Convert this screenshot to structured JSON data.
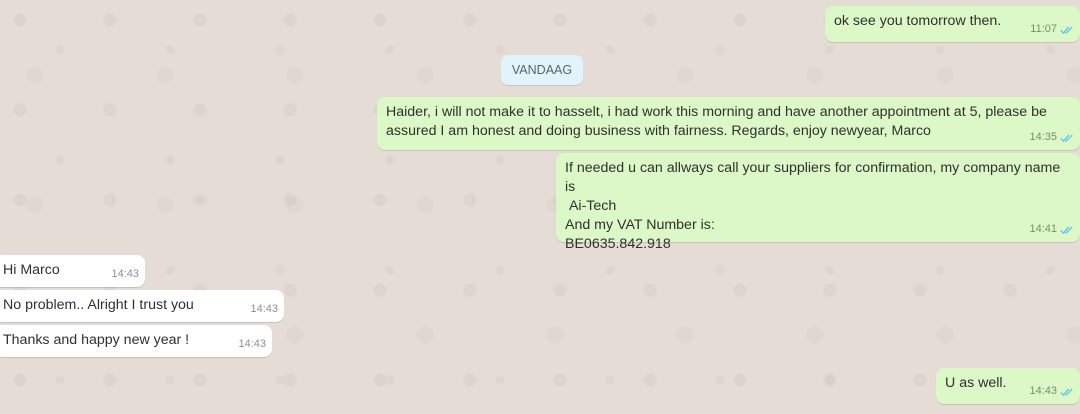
{
  "chat": {
    "date_divider": "VANDAAG",
    "messages": [
      {
        "direction": "outgoing",
        "text": "ok see you tomorrow then.",
        "time": "11:07",
        "status": "read"
      },
      {
        "direction": "outgoing",
        "text": "Haider, i will not make it to hasselt, i had work this morning and have another appointment at 5, please be assured I am honest and doing business with fairness. Regards, enjoy newyear, Marco",
        "time": "14:35",
        "status": "read"
      },
      {
        "direction": "outgoing",
        "text": "If needed u can allways call your suppliers for confirmation, my company name is\n Ai-Tech\nAnd my VAT Number is:\nBE0635.842.918",
        "time": "14:41",
        "status": "read"
      },
      {
        "direction": "incoming",
        "text": "Hi Marco",
        "time": "14:43"
      },
      {
        "direction": "incoming",
        "text": "No problem.. Alright I trust you",
        "time": "14:43"
      },
      {
        "direction": "incoming",
        "text": "Thanks and happy new year !",
        "time": "14:43"
      },
      {
        "direction": "outgoing",
        "text": "U as well.",
        "time": "14:43",
        "status": "read"
      }
    ]
  },
  "colors": {
    "background": "#e5ddd5",
    "outgoing_bubble": "#dcf8c6",
    "incoming_bubble": "#ffffff",
    "date_pill": "#e1f3fb",
    "read_ticks": "#4fc3f7"
  },
  "icons": {
    "read_receipt": "double-check-icon"
  }
}
